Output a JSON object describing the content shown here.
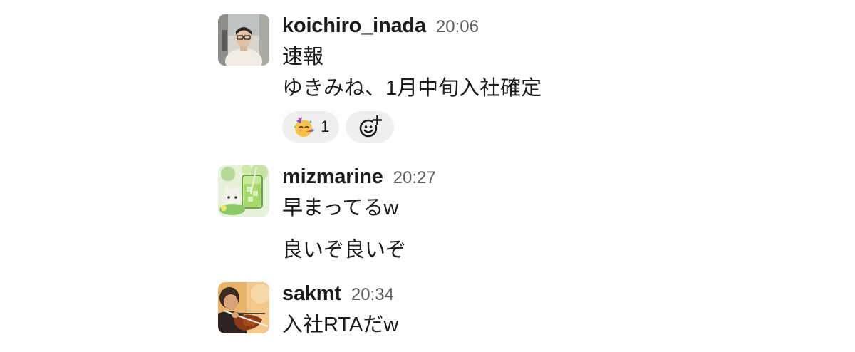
{
  "messages": [
    {
      "username": "koichiro_inada",
      "time": "20:06",
      "lines": [
        "速報",
        "ゆきみね、1月中旬入社確定"
      ],
      "reactions": [
        {
          "emoji": "partying-face",
          "count": "1"
        }
      ]
    },
    {
      "username": "mizmarine",
      "time": "20:27",
      "lines": [
        "早まってるw",
        "良いぞ良いぞ"
      ]
    },
    {
      "username": "sakmt",
      "time": "20:34",
      "lines": [
        "入社RTAだw"
      ]
    }
  ],
  "colors": {
    "text": "#1d1c1d",
    "timestamp": "#616061",
    "reaction_bg": "#efefef"
  }
}
